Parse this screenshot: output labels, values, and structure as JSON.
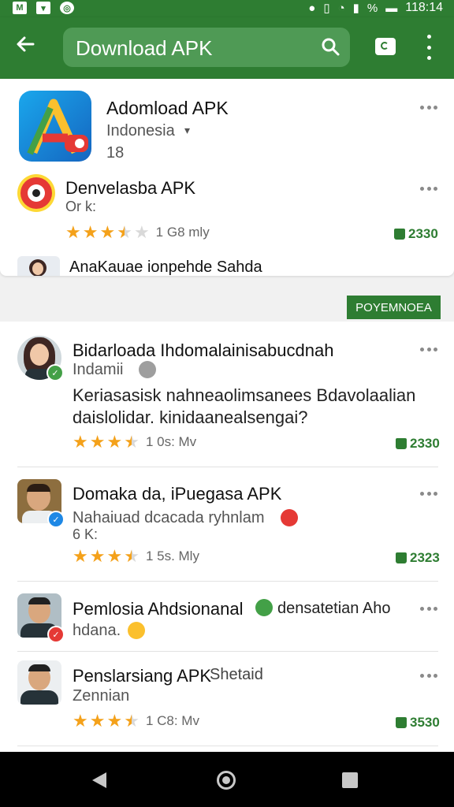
{
  "status_bar": {
    "time": "118:14",
    "battery": "%"
  },
  "app_bar": {
    "search_text": "Download APK"
  },
  "top_card": {
    "app": {
      "title": "Adomload APK",
      "region": "Indonesia",
      "caret": "▾",
      "count": "18"
    },
    "item": {
      "title": "Denvelasba APK",
      "sub": "Or k:",
      "rating_text": "1 G8 mly",
      "likes": "2330"
    },
    "partial_item": {
      "title": "AnaKauae ionpehde Sahda"
    }
  },
  "section_tag": "POYEMNOEA",
  "list": [
    {
      "title": "Bidarloada Ihdomalainisabucdnah",
      "sub": "Indamii",
      "body1": "Keriasasisk nahneaolimsanees Bdavolaalian",
      "body2": "daislolidar. kinidaanealsengai?",
      "rating_text": "1 0s: Mv",
      "likes": "2330"
    },
    {
      "title": "Domaka da, iPuegasa APK",
      "sub": "Nahaiuad dcacada ryhnlam",
      "sub2": "6 K:",
      "rating_text": "1 5s. Mly",
      "likes": "2323"
    },
    {
      "title": "Pemlosia Ahdsionanal",
      "title_tail": "densatetian Aho",
      "sub": "hdana."
    },
    {
      "title": "Penslarsiang APK",
      "title_tail": "Shetaid",
      "sub": "Zennian",
      "rating_text": "1 C8: Mv",
      "likes": "3530"
    }
  ],
  "colors": {
    "primary": "#2e7d32",
    "star": "#f4a11a"
  },
  "icons": [
    "back-arrow-icon",
    "search-icon",
    "tab-icon",
    "more-vert-icon",
    "thumb-up-icon",
    "star-icon"
  ]
}
